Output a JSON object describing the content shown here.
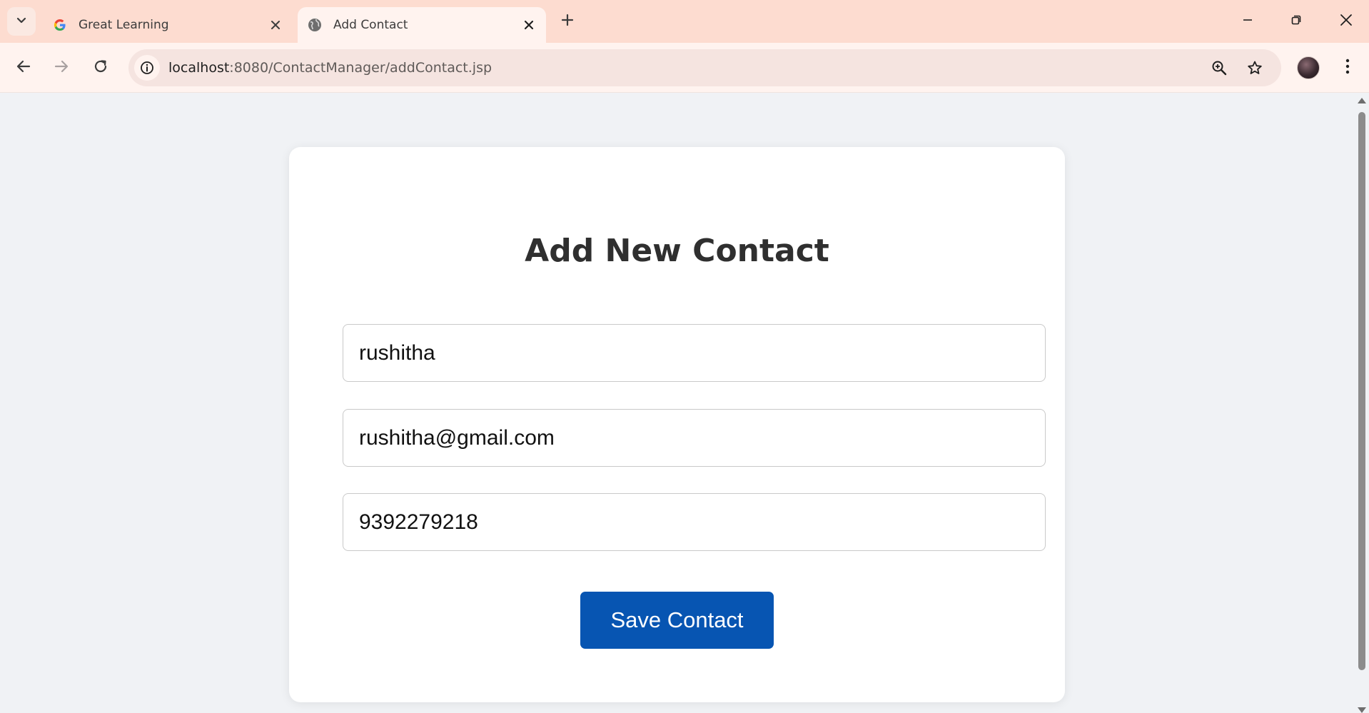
{
  "browser": {
    "tabs": [
      {
        "title": "Great Learning",
        "favicon": "google-g-icon",
        "active": false
      },
      {
        "title": "Add Contact",
        "favicon": "globe-icon",
        "active": true
      }
    ],
    "address_bar": {
      "host": "localhost",
      "rest": ":8080/ContactManager/addContact.jsp"
    }
  },
  "page": {
    "title": "Add New Contact",
    "form": {
      "name_value": "rushitha",
      "email_value": "rushitha@gmail.com",
      "phone_value": "9392279218",
      "submit_label": "Save Contact"
    }
  },
  "colors": {
    "tabstrip": "#fddcd0",
    "toolbar": "#fff3ef",
    "page_background": "#f0f2f5",
    "primary_button": "#0755b2"
  }
}
